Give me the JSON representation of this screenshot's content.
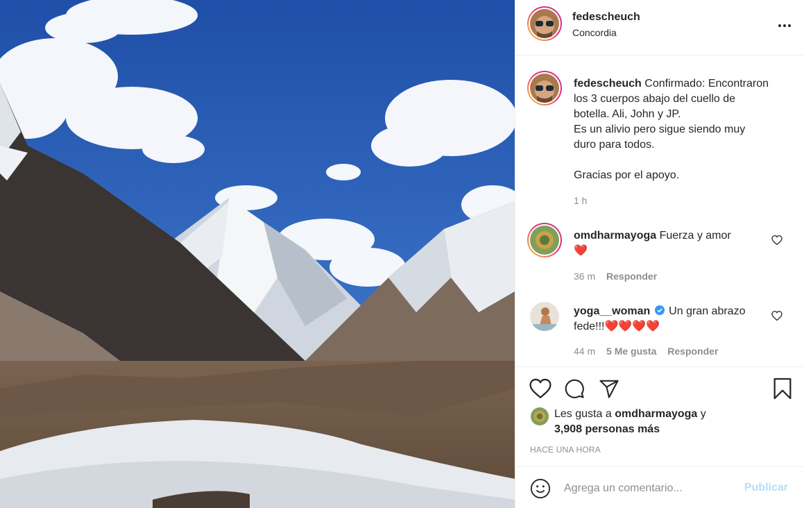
{
  "post": {
    "username": "fedescheuch",
    "location": "Concordia"
  },
  "caption": {
    "username": "fedescheuch",
    "line1": "Confirmado: Encontraron",
    "line2": "los 3 cuerpos abajo del cuello de",
    "line3": "botella. Ali, John y JP.",
    "line4": "Es un alivio pero sigue siendo muy",
    "line5": "duro para todos.",
    "line6": "Gracias por el apoyo.",
    "time": "1 h"
  },
  "comments": [
    {
      "username": "omdharmayoga",
      "text": "Fuerza y amor",
      "emoji": "❤️",
      "time": "36 m",
      "reply_label": "Responder"
    },
    {
      "username": "yoga__woman",
      "verified": true,
      "text_line1": "Un gran abrazo",
      "text_line2": "fede!!!",
      "emoji": "❤️❤️❤️❤️",
      "time": "44 m",
      "likes_label": "5 Me gusta",
      "reply_label": "Responder"
    }
  ],
  "likes": {
    "prefix": "Les gusta a",
    "user": "omdharmayoga",
    "joiner": "y",
    "others": "3,908 personas más"
  },
  "timestamp": "HACE UNA HORA",
  "add_comment": {
    "placeholder": "Agrega un comentario...",
    "publish_label": "Publicar"
  },
  "icons": {
    "more": "more-horizontal-icon",
    "like": "heart-icon",
    "comment": "comment-icon",
    "share": "send-icon",
    "save": "bookmark-icon",
    "emoji": "emoji-icon"
  },
  "colors": {
    "text": "#262626",
    "secondary": "#8e8e8e",
    "publish_disabled": "#b2dffc",
    "verified": "#3897f0",
    "heart": "#ed4956"
  }
}
